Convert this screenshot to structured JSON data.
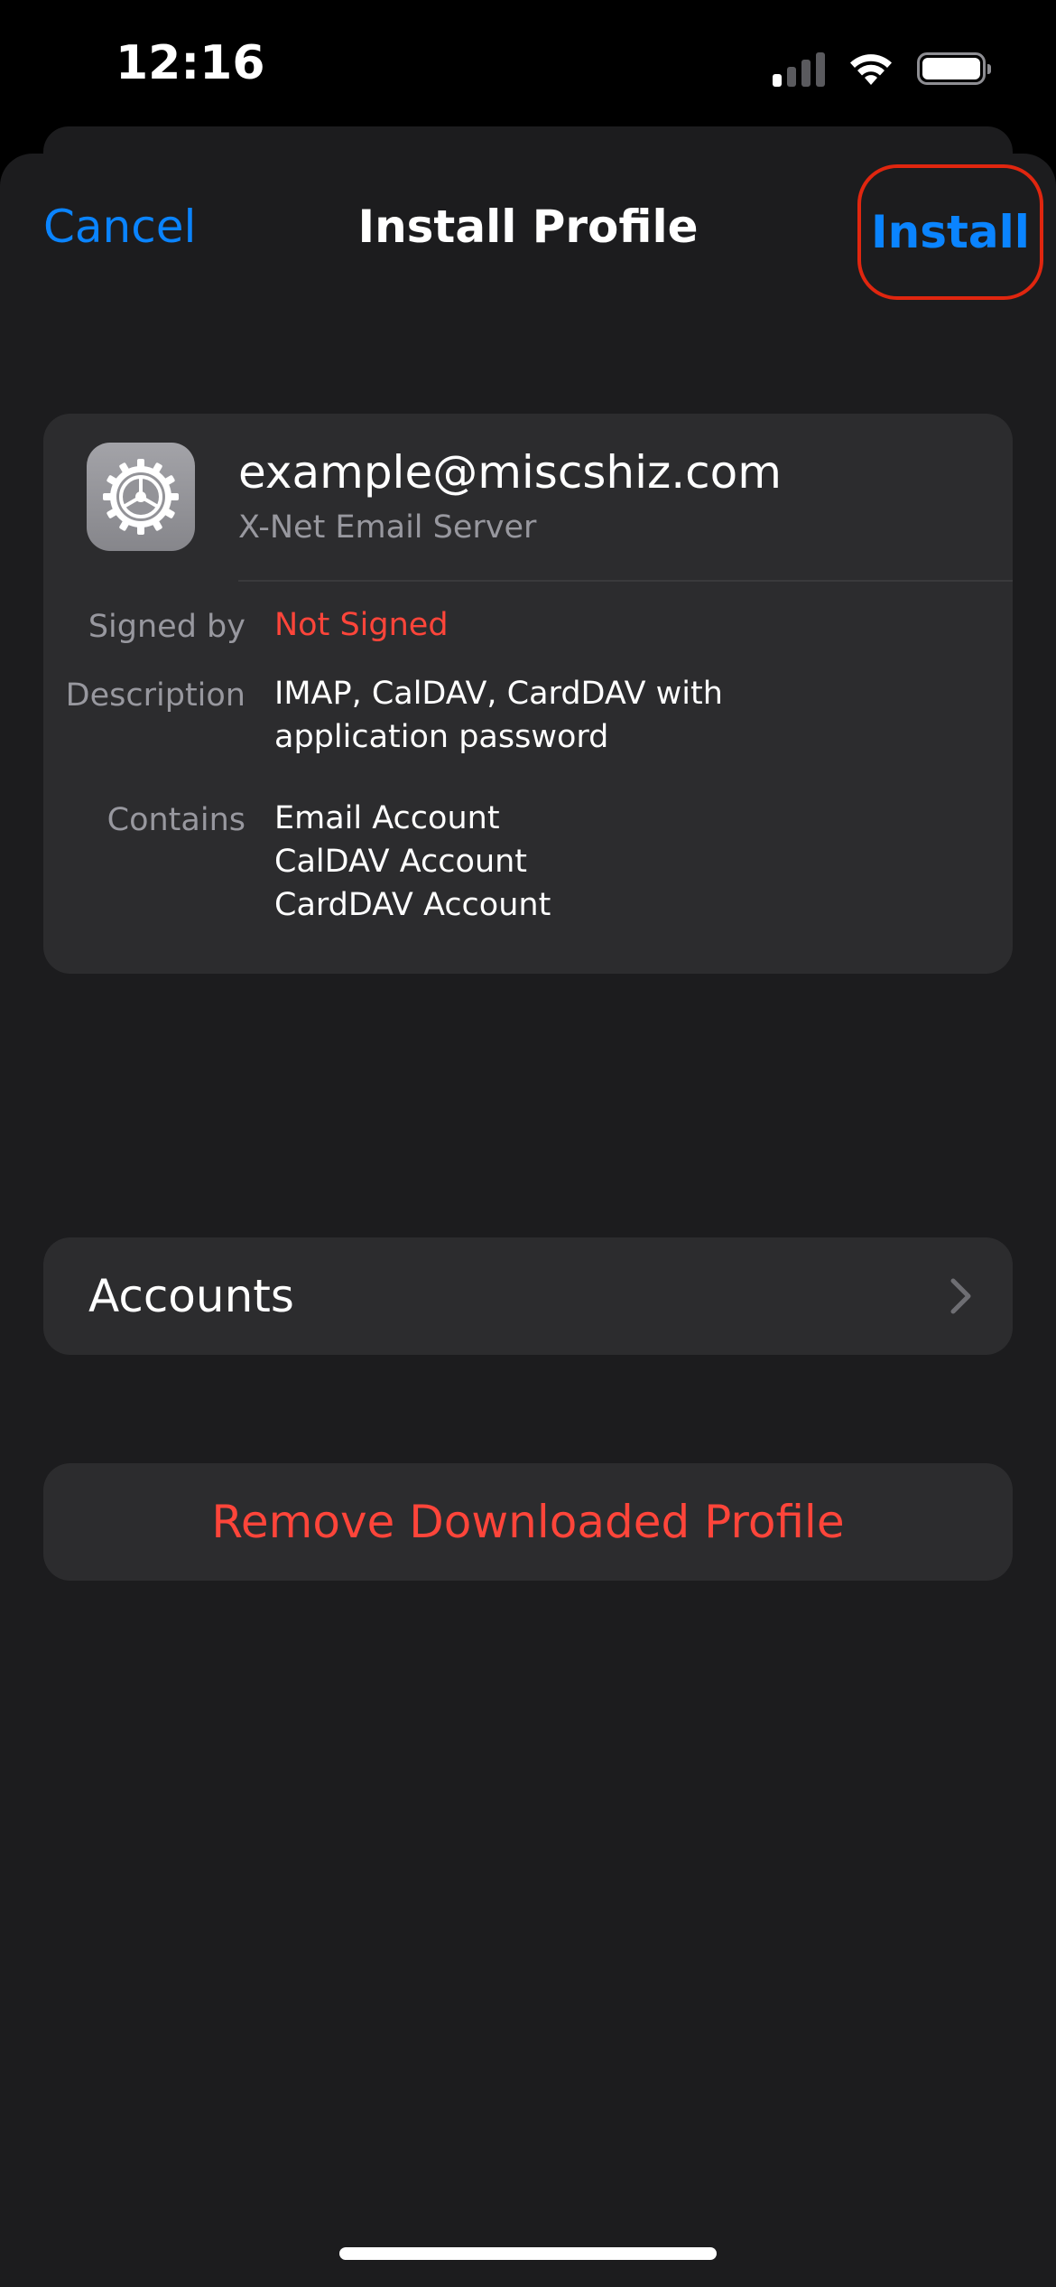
{
  "status_bar": {
    "time": "12:16",
    "signal_bars_on": 1,
    "signal_bars_total": 4
  },
  "nav": {
    "cancel_label": "Cancel",
    "title": "Install Profile",
    "install_label": "Install"
  },
  "profile": {
    "name": "example@miscshiz.com",
    "subtitle": "X-Net Email Server",
    "icon": "gear-icon",
    "details": {
      "signed_by_label": "Signed by",
      "signed_by_value": "Not Signed",
      "description_label": "Description",
      "description_line1": "IMAP, CalDAV, CardDAV with",
      "description_line2": "application password",
      "contains_label": "Contains",
      "contains_items": [
        "Email Account",
        "CalDAV Account",
        "CardDAV Account"
      ]
    }
  },
  "accounts_row": {
    "label": "Accounts",
    "icon": "chevron-right-icon"
  },
  "remove_row": {
    "label": "Remove Downloaded Profile"
  },
  "colors": {
    "accent": "#0a84ff",
    "danger": "#ff453a",
    "highlight_outline": "#e0260f",
    "sheet_background": "#1c1c1e",
    "cell_background": "#2c2c2e"
  }
}
